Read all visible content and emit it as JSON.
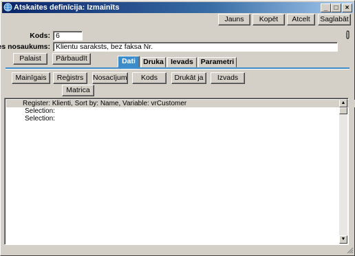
{
  "window": {
    "title": "Atskaites definīcija: Izmainīts",
    "min_glyph": "_",
    "max_glyph": "□",
    "close_glyph": "×"
  },
  "toolbar": {
    "jauns": "Jauns",
    "kopet": "Kopēt",
    "atcelt": "Atcelt",
    "saglabat": "Saglabāt"
  },
  "form": {
    "kods_label": "Kods:",
    "kods_value": "6",
    "name_label": "caites nosaukums:",
    "name_value": "Klientu saraksts, bez faksa Nr."
  },
  "actions": {
    "palaist": "Palaist",
    "parbaudit": "Pārbaudīt"
  },
  "tabs": [
    "Dati",
    "Druka",
    "Ievads",
    "Parametri"
  ],
  "data_buttons": {
    "mainigais": "Mainīgais",
    "registrs": "Reģistrs",
    "nosacijums": "Nosacījums",
    "kods": "Kods",
    "drukat_ja": "Drukāt ja",
    "izvads": "Izvads",
    "matrica": "Matrica"
  },
  "list": {
    "rows": [
      "Register: Klienti, Sort by: Name, Variable: vrCustomer",
      "Selection:",
      "Selection:"
    ]
  },
  "colors": {
    "accent_tab": "#3c8ccc",
    "title_start": "#0a246a",
    "rule_blue": "#3c8ccc"
  }
}
